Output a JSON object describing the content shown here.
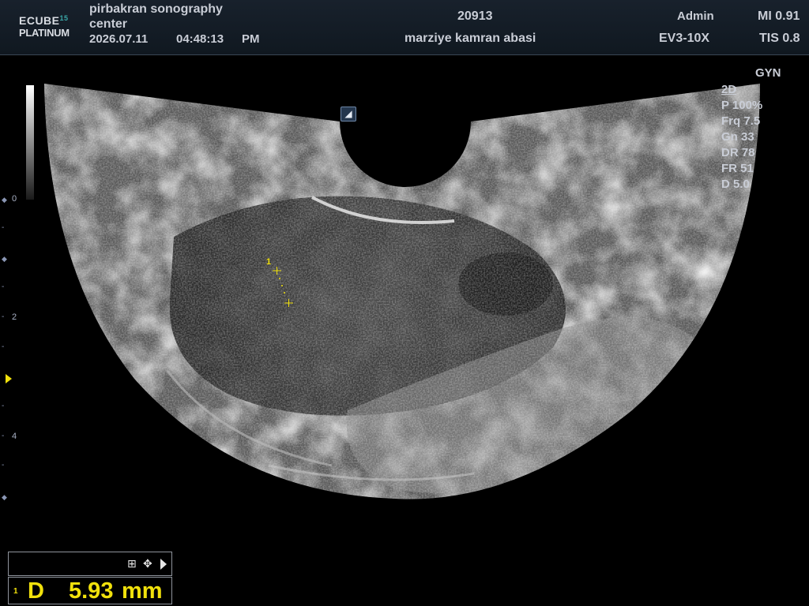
{
  "header": {
    "logo_line1": "ECUBE",
    "logo_sup": "15",
    "logo_line2": "PLATINUM",
    "institution_line1": "pirbakran sonography",
    "institution_line2": "center",
    "date": "2026.07.11",
    "time": "04:48:13",
    "ampm": "PM",
    "patient_id": "20913",
    "patient_name": "marziye kamran abasi",
    "operator": "Admin",
    "probe": "EV3-10X",
    "mi": "MI 0.91",
    "tis": "TIS 0.8"
  },
  "preset": "GYN",
  "params": {
    "mode": "2D",
    "power": "P 100%",
    "frequency": "Frq 7.5",
    "gain": "Gn 33",
    "dynamic_range": "DR 78",
    "frame_rate": "FR 51",
    "depth": "D 5.0"
  },
  "depth_scale": {
    "labels": [
      "0",
      "2",
      "4"
    ]
  },
  "measurement": {
    "marker_index": "1",
    "result_index": "1",
    "letter": "D",
    "value": "5.93",
    "unit": "mm"
  },
  "icons": {
    "probe_orientation": "probe-orientation-icon",
    "grid_tool": "grid-icon",
    "move_tool": "move-icon",
    "next_tool": "play-icon"
  },
  "colors": {
    "measurement": "#f1e10c",
    "header_bg": "#141c26",
    "text": "#c9cdd6",
    "logo_accent": "#3aa7a7"
  }
}
